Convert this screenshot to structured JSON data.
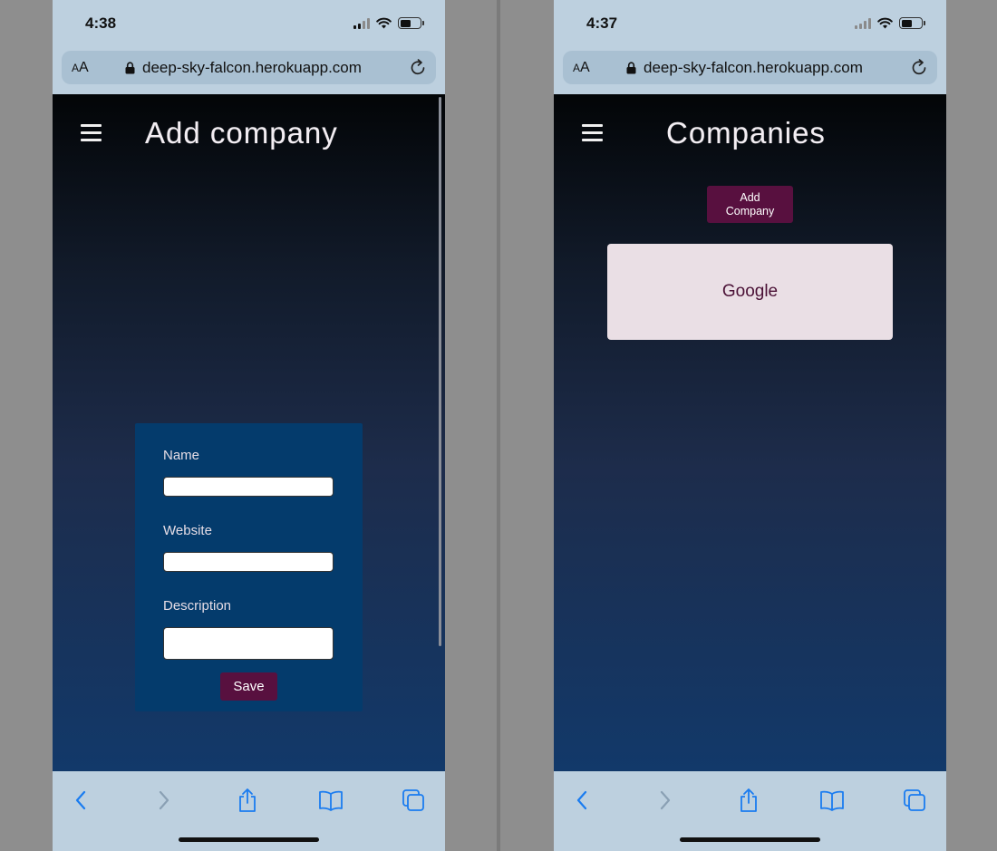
{
  "left_screen": {
    "status_bar": {
      "time": "4:38"
    },
    "url_bar": {
      "text_size_label": "AA",
      "url": "deep-sky-falcon.herokuapp.com"
    },
    "page": {
      "title": "Add company",
      "form": {
        "fields": [
          {
            "label": "Name",
            "value": ""
          },
          {
            "label": "Website",
            "value": ""
          },
          {
            "label": "Description",
            "value": ""
          }
        ],
        "save_label": "Save"
      }
    }
  },
  "right_screen": {
    "status_bar": {
      "time": "4:37"
    },
    "url_bar": {
      "text_size_label": "AA",
      "url": "deep-sky-falcon.herokuapp.com"
    },
    "page": {
      "title": "Companies",
      "add_button_label": "Add Company",
      "companies": [
        {
          "name": "Google"
        }
      ]
    }
  },
  "colors": {
    "browser_chrome": "#bdd0df",
    "button_maroon": "#58103f",
    "form_card_blue": "#043b6c",
    "company_card_bg": "#eadfe5",
    "ios_blue": "#1a7cf0"
  },
  "icons": {
    "menu": "hamburger-icon",
    "lock": "lock-icon",
    "reload": "reload-icon",
    "back": "back-chevron-icon",
    "forward": "forward-chevron-icon",
    "share": "share-icon",
    "bookmarks": "bookmarks-icon",
    "tabs": "tabs-icon"
  }
}
